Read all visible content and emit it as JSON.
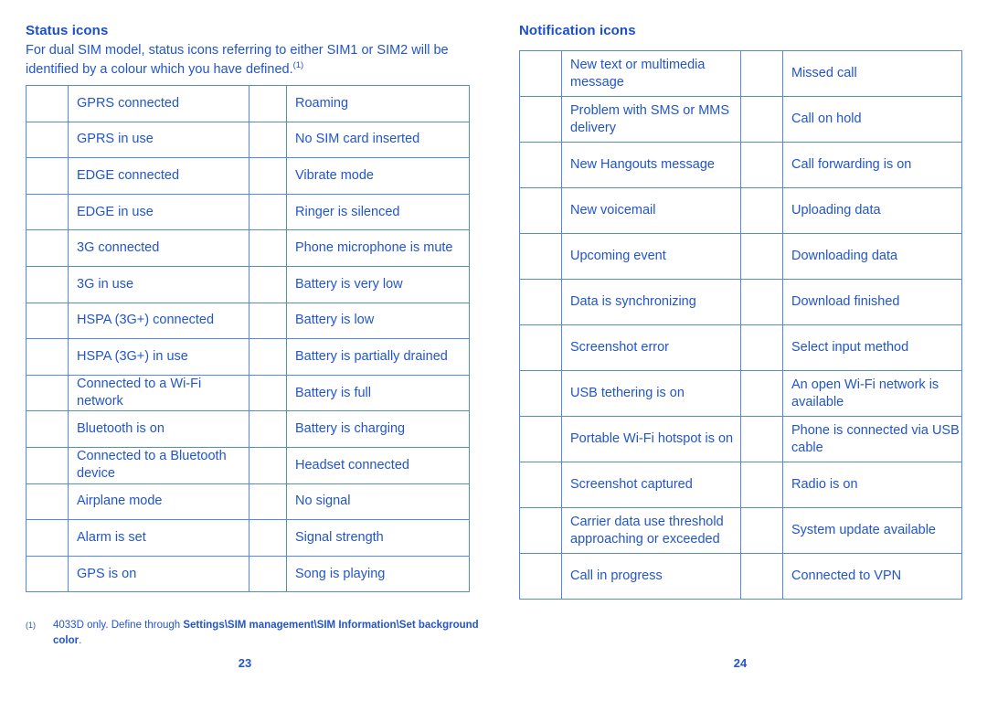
{
  "left_page": {
    "heading": "Status icons",
    "intro": "For dual SIM model, status icons referring to either SIM1 or SIM2 will be identified by a colour which you have defined.",
    "intro_footnote_marker": "(1)",
    "page_number": "23",
    "footnote": {
      "marker": "(1)",
      "text_before": "4033D only. Define through ",
      "bold_path": "Settings\\SIM management\\SIM Information\\Set background color",
      "text_after": "."
    },
    "table": {
      "rows": [
        {
          "icon_left": "gprs-connected-icon",
          "label_left": "GPRS connected",
          "icon_right": "roaming-icon",
          "label_right": "Roaming"
        },
        {
          "icon_left": "gprs-in-use-icon",
          "label_left": "GPRS in use",
          "icon_right": "no-sim-card-icon",
          "label_right": "No SIM card inserted"
        },
        {
          "icon_left": "edge-connected-icon",
          "label_left": "EDGE connected",
          "icon_right": "vibrate-mode-icon",
          "label_right": "Vibrate mode"
        },
        {
          "icon_left": "edge-in-use-icon",
          "label_left": "EDGE in use",
          "icon_right": "ringer-silenced-icon",
          "label_right": "Ringer is silenced"
        },
        {
          "icon_left": "3g-connected-icon",
          "label_left": "3G connected",
          "icon_right": "microphone-mute-icon",
          "label_right": "Phone microphone is mute"
        },
        {
          "icon_left": "3g-in-use-icon",
          "label_left": "3G in use",
          "icon_right": "battery-very-low-icon",
          "label_right": "Battery is very low"
        },
        {
          "icon_left": "hspa-connected-icon",
          "label_left": "HSPA (3G+) connected",
          "icon_right": "battery-low-icon",
          "label_right": "Battery is low"
        },
        {
          "icon_left": "hspa-in-use-icon",
          "label_left": "HSPA (3G+) in use",
          "icon_right": "battery-partially-drained-icon",
          "label_right": "Battery is partially drained"
        },
        {
          "icon_left": "wifi-connected-icon",
          "label_left": "Connected to a Wi-Fi network",
          "icon_right": "battery-full-icon",
          "label_right": "Battery is full"
        },
        {
          "icon_left": "bluetooth-on-icon",
          "label_left": "Bluetooth is on",
          "icon_right": "battery-charging-icon",
          "label_right": "Battery is charging"
        },
        {
          "icon_left": "bluetooth-connected-icon",
          "label_left": "Connected to a Bluetooth device",
          "icon_right": "headset-connected-icon",
          "label_right": "Headset connected"
        },
        {
          "icon_left": "airplane-mode-icon",
          "label_left": "Airplane mode",
          "icon_right": "no-signal-icon",
          "label_right": "No signal"
        },
        {
          "icon_left": "alarm-set-icon",
          "label_left": "Alarm is set",
          "icon_right": "signal-strength-icon",
          "label_right": "Signal strength"
        },
        {
          "icon_left": "gps-on-icon",
          "label_left": "GPS is on",
          "icon_right": "song-playing-icon",
          "label_right": "Song is playing"
        }
      ]
    }
  },
  "right_page": {
    "heading": "Notification icons",
    "page_number": "24",
    "table": {
      "rows": [
        {
          "icon_left": "new-message-icon",
          "label_left": "New text or multimedia message",
          "icon_right": "missed-call-icon",
          "label_right": "Missed call"
        },
        {
          "icon_left": "sms-mms-problem-icon",
          "label_left": "Problem with SMS or MMS delivery",
          "icon_right": "call-on-hold-icon",
          "label_right": "Call on hold"
        },
        {
          "icon_left": "hangouts-message-icon",
          "label_left": "New Hangouts message",
          "icon_right": "call-forwarding-icon",
          "label_right": "Call forwarding is on"
        },
        {
          "icon_left": "new-voicemail-icon",
          "label_left": "New voicemail",
          "icon_right": "uploading-data-icon",
          "label_right": "Uploading data"
        },
        {
          "icon_left": "upcoming-event-icon",
          "label_left": "Upcoming event",
          "icon_right": "downloading-data-icon",
          "label_right": "Downloading data"
        },
        {
          "icon_left": "data-syncing-icon",
          "label_left": "Data is synchronizing",
          "icon_right": "download-finished-icon",
          "label_right": "Download finished"
        },
        {
          "icon_left": "screenshot-error-icon",
          "label_left": "Screenshot error",
          "icon_right": "select-input-method-icon",
          "label_right": "Select input method"
        },
        {
          "icon_left": "usb-tethering-icon",
          "label_left": "USB tethering is on",
          "icon_right": "open-wifi-network-icon",
          "label_right": "An open Wi-Fi network is available"
        },
        {
          "icon_left": "portable-hotspot-icon",
          "label_left": "Portable Wi-Fi hotspot is on",
          "icon_right": "usb-connected-icon",
          "label_right": "Phone is connected via USB cable"
        },
        {
          "icon_left": "screenshot-captured-icon",
          "label_left": "Screenshot captured",
          "icon_right": "radio-on-icon",
          "label_right": "Radio is on"
        },
        {
          "icon_left": "carrier-data-threshold-icon",
          "label_left": "Carrier data use threshold approaching or exceeded",
          "icon_right": "system-update-icon",
          "label_right": "System update available"
        },
        {
          "icon_left": "call-in-progress-icon",
          "label_left": "Call in progress",
          "icon_right": "vpn-connected-icon",
          "label_right": "Connected to VPN"
        }
      ]
    }
  },
  "colors": {
    "heading_blue": "#1a4fd0",
    "text_blue": "#2255cc",
    "border_blue": "#5588e0"
  }
}
